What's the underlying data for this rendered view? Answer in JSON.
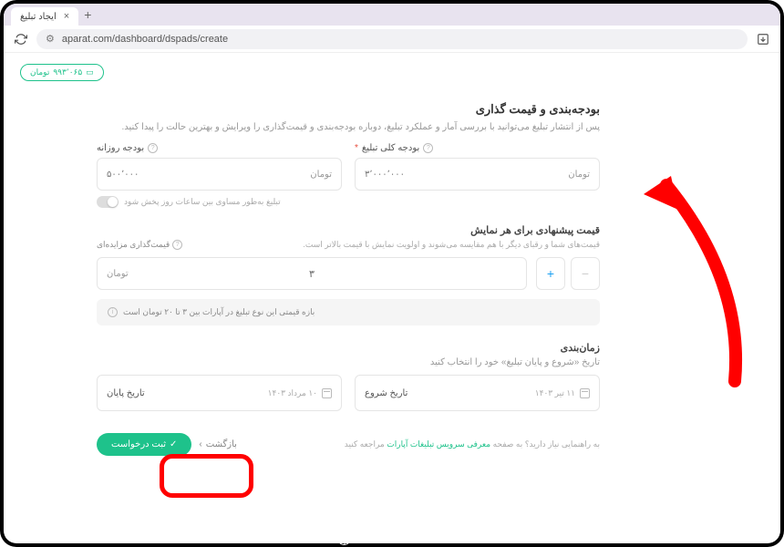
{
  "browser": {
    "tab_title": "ایجاد تبلیغ",
    "url": "aparat.com/dashboard/dspads/create"
  },
  "balance": {
    "amount": "۹۹۳٬۰۶۵",
    "unit": "تومان"
  },
  "budget_section": {
    "title": "بودجه‌بندی و قیمت گذاری",
    "desc": "پس از انتشار تبلیغ می‌توانید با بررسی آمار و عملکرد تبلیغ، دوباره بودجه‌بندی و قیمت‌گذاری را ویرایش و بهترین حالت را پیدا کنید.",
    "total_budget_label": "بودجه کلی تبلیغ",
    "total_budget_placeholder": "۳٬۰۰۰٬۰۰۰",
    "daily_budget_label": "بودجه روزانه",
    "daily_budget_placeholder": "۵۰۰٬۰۰۰",
    "currency": "تومان",
    "toggle_label": "تبلیغ به‌طور مساوی بین ساعات روز پخش شود"
  },
  "price_section": {
    "title": "قیمت پیشنهادی برای هر نمایش",
    "desc": "قیمت‌های شما و رقبای دیگر با هم مقایسه می‌شوند و اولویت نمایش با قیمت بالاتر است.",
    "auction_label": "قیمت‌گذاری مزایده‌ای",
    "value": "۳",
    "currency": "تومان",
    "info_text": "بازه قیمتی این نوع تبلیغ در آپارات بین ۳ تا ۲۰ تومان است"
  },
  "schedule_section": {
    "title": "زمان‌بندی",
    "desc": "تاریخ «شروع و پایان تبلیغ» خود را انتخاب کنید",
    "start_label": "تاریخ شروع",
    "start_value": "۱۱ تیر ۱۴۰۳",
    "end_label": "تاریخ پایان",
    "end_value": "۱۰ مرداد ۱۴۰۳"
  },
  "footer": {
    "help_prefix": "به راهنمایی نیاز دارید؟ به صفحه ",
    "help_link": "معرفی سرویس تبلیغات آپارات",
    "help_suffix": " مراجعه کنید",
    "back_label": "بازگشت",
    "submit_label": "ثبت درخواست"
  },
  "watermark": "Followeran.com"
}
